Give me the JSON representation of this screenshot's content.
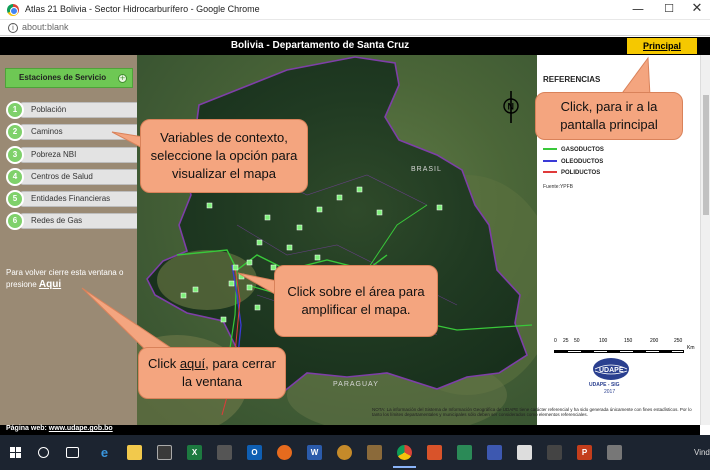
{
  "browser": {
    "window_title": "Atlas 21 Bolivia - Sector Hidrocarburífero - Google Chrome",
    "url": "about:blank",
    "minimize": "—",
    "maximize": "☐",
    "close": "✕"
  },
  "header": {
    "title": "Bolivia - Departamento de Santa Cruz",
    "principal_link": "Principal"
  },
  "sidebar": {
    "section_label": "Estaciones de Servicio",
    "section_toggle": "+",
    "items": [
      {
        "num": "1",
        "label": "Población"
      },
      {
        "num": "2",
        "label": "Caminos"
      },
      {
        "num": "3",
        "label": "Pobreza  NBI"
      },
      {
        "num": "4",
        "label": "Centros de Salud"
      },
      {
        "num": "5",
        "label": "Entidades Financieras"
      },
      {
        "num": "6",
        "label": "Redes de Gas"
      }
    ],
    "close_note": "Para volver cierre esta ventana o presione",
    "aqui_link": "Aqui"
  },
  "map": {
    "label_brasil": "BRASIL",
    "label_paraguay": "PARAGUAY",
    "north_letter": "N"
  },
  "references": {
    "title": "REFERENCIAS",
    "legend": [
      {
        "label": "GASODUCTOS",
        "color": "#39c83a"
      },
      {
        "label": "OLEODUCTOS",
        "color": "#3a3ad6"
      },
      {
        "label": "POLIDUCTOS",
        "color": "#e03a3a"
      }
    ],
    "source": "Fuente:YPFB",
    "scale_ticks": [
      "0",
      "25",
      "50",
      "100",
      "150",
      "200",
      "250"
    ],
    "scale_unit": "Km",
    "logo_text": "UDAPE",
    "logo_caption": "UDAPE - SIG",
    "logo_year": "2017"
  },
  "footer": {
    "note": "NOTA: La información del Sistema de Información Geográfica de UDAPE tiene carácter referencial y ha sido generada únicamente con fines estadísticos. Por lo tanto los límites departamentales y municipales sólo deben ser considerados como elementos referenciales.",
    "web_label": "Página web:",
    "web_url": "www.udape.gob.bo"
  },
  "callouts": {
    "principal": "Click, para ir a la pantalla principal",
    "variables": "Variables de contexto, seleccione la opción para visualizar el mapa",
    "amplificar": "Click sobre el área para amplificar el mapa.",
    "cerrar_pre": "Click ",
    "cerrar_link": "aquí",
    "cerrar_post": ", para cerrar la ventana"
  },
  "taskbar": {
    "corner_text": "Vind",
    "colors": {
      "bg": "#1c2430",
      "accent": "#8ab4f8"
    }
  },
  "colors": {
    "sidebar_bg": "#9a8a74",
    "section_green": "#6ec854",
    "principal_yellow": "#f5c800",
    "callout": "#f4a57f",
    "boundary_purple": "#7e3fa8"
  }
}
